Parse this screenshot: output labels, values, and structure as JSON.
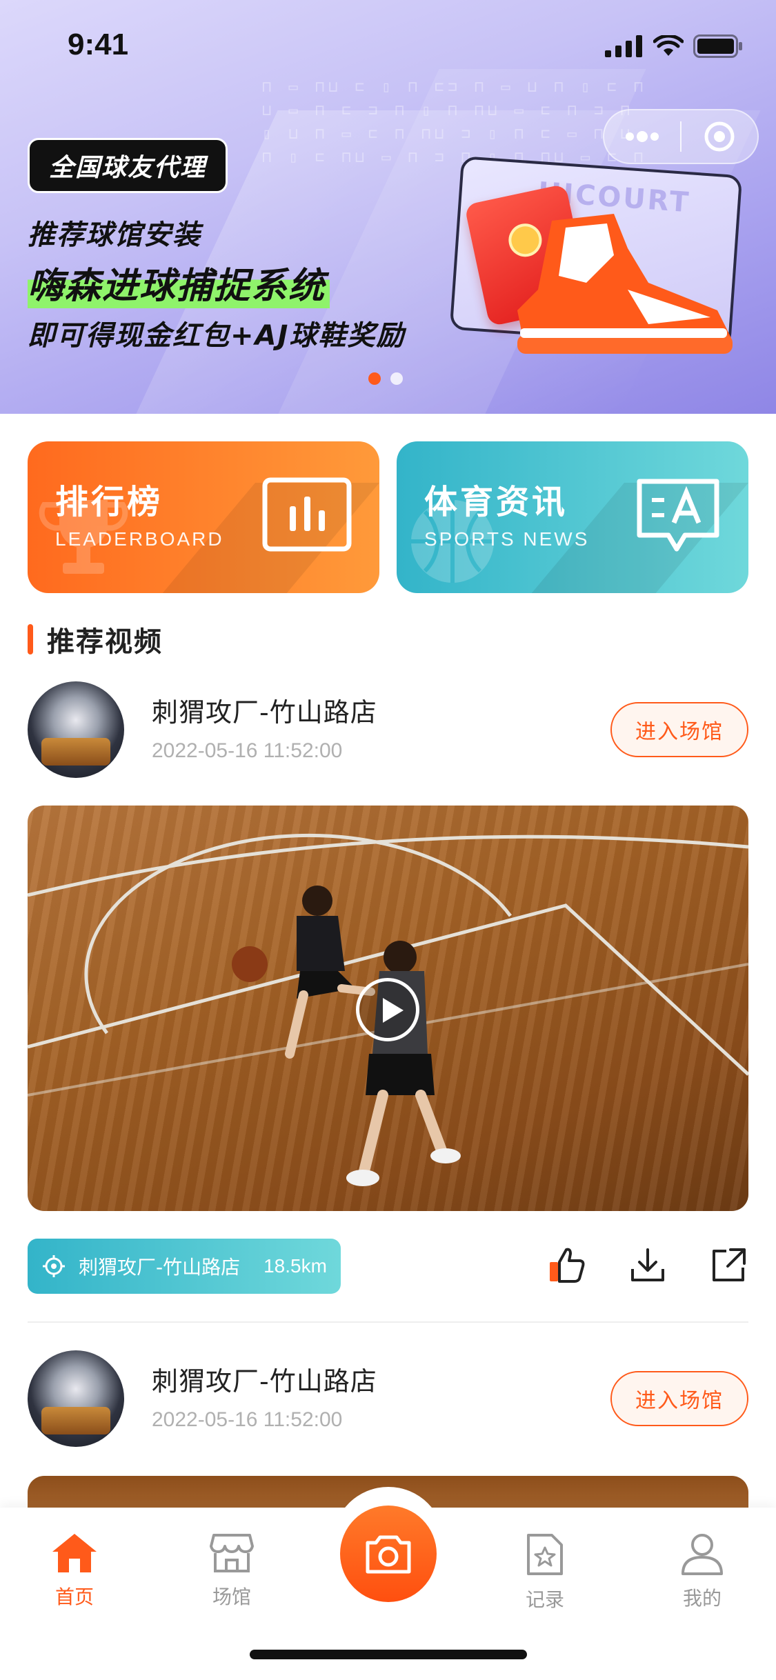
{
  "status_bar": {
    "time": "9:41"
  },
  "banner": {
    "tag": "全国球友代理",
    "line1": "推荐球馆安装",
    "line2": "嗨森进球捕捉系统",
    "line3": "即可得现金红包+AJ球鞋奖励",
    "card_brand": "HICOURT",
    "page_count": 2,
    "active_page": 1
  },
  "features": [
    {
      "title": "排行榜",
      "subtitle": "LEADERBOARD",
      "icon": "bar-chart-icon"
    },
    {
      "title": "体育资讯",
      "subtitle": "SPORTS NEWS",
      "icon": "news-chat-icon"
    }
  ],
  "section": {
    "title": "推荐视频"
  },
  "posts": [
    {
      "venue": "刺猬攻厂-竹山路店",
      "time": "2022-05-16 11:52:00",
      "enter_label": "进入场馆",
      "location_label": "刺猬攻厂-竹山路店",
      "distance": "18.5km"
    },
    {
      "venue": "刺猬攻厂-竹山路店",
      "time": "2022-05-16 11:52:00",
      "enter_label": "进入场馆"
    }
  ],
  "tabbar": {
    "items": [
      {
        "label": "首页",
        "icon": "home-icon",
        "active": true
      },
      {
        "label": "场馆",
        "icon": "store-icon",
        "active": false
      },
      {
        "label": "",
        "icon": "camera-icon",
        "active": false
      },
      {
        "label": "记录",
        "icon": "record-star-icon",
        "active": false
      },
      {
        "label": "我的",
        "icon": "user-icon",
        "active": false
      }
    ]
  },
  "colors": {
    "accent": "#ff5a1a",
    "teal": "#33b4c9",
    "banner": "#a9a2ef"
  }
}
